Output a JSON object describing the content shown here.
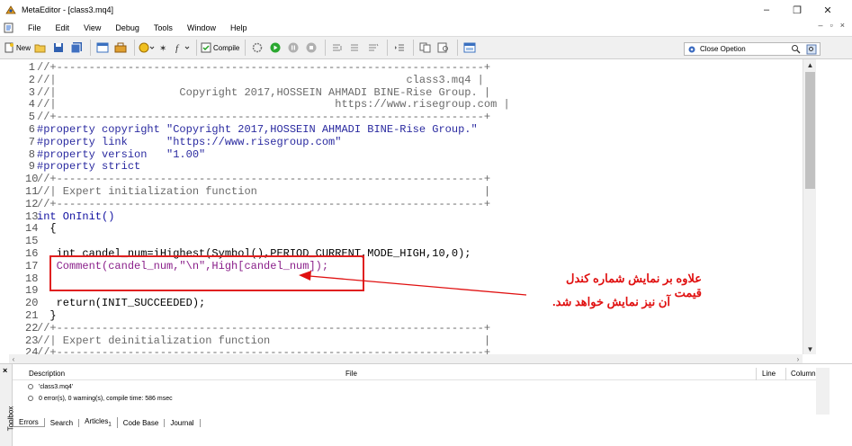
{
  "window": {
    "title": "MetaEditor - [class3.mq4]",
    "minimize": "–",
    "maximize": "❐",
    "close": "✕"
  },
  "menu": {
    "items": [
      "File",
      "Edit",
      "View",
      "Debug",
      "Tools",
      "Window",
      "Help"
    ],
    "mdi": [
      "–",
      "▫",
      "×"
    ]
  },
  "toolbar": {
    "new_label": "New",
    "compile_label": "Compile"
  },
  "search": {
    "value": "Close Opetion"
  },
  "editor": {
    "lines": [
      {
        "n": "1",
        "code": "//+------------------------------------------------------------------+",
        "cls": "c-comment"
      },
      {
        "n": "2",
        "code": "//|                                                      class3.mq4 |",
        "cls": "c-comment"
      },
      {
        "n": "3",
        "code": "//|                   Copyright 2017,HOSSEIN AHMADI BINE-Rise Group. |",
        "cls": "c-comment"
      },
      {
        "n": "4",
        "code": "//|                                           https://www.risegroup.com |",
        "cls": "c-comment"
      },
      {
        "n": "5",
        "code": "//+------------------------------------------------------------------+",
        "cls": "c-comment"
      },
      {
        "n": "6",
        "code": "#property copyright \"Copyright 2017,HOSSEIN AHMADI BINE-Rise Group.\"",
        "cls": "c-prop"
      },
      {
        "n": "7",
        "code": "#property link      \"https://www.risegroup.com\"",
        "cls": "c-prop"
      },
      {
        "n": "8",
        "code": "#property version   \"1.00\"",
        "cls": "c-prop"
      },
      {
        "n": "9",
        "code": "#property strict",
        "cls": "c-prop"
      },
      {
        "n": "10",
        "code": "//+------------------------------------------------------------------+",
        "cls": "c-comment"
      },
      {
        "n": "11",
        "code": "//| Expert initialization function                                   |",
        "cls": "c-comment"
      },
      {
        "n": "12",
        "code": "//+------------------------------------------------------------------+",
        "cls": "c-comment"
      },
      {
        "n": "13",
        "code": "int OnInit()",
        "cls": "c-kw"
      },
      {
        "n": "14",
        "code": "  {",
        "cls": "c-text"
      },
      {
        "n": "15",
        "code": "",
        "cls": "c-text"
      },
      {
        "n": "16",
        "code": "   int candel_num=iHighest(Symbol(),PERIOD_CURRENT,MODE_HIGH,10,0);",
        "cls": "c-text"
      },
      {
        "n": "17",
        "code": "   Comment(candel_num,\"\\n\",High[candel_num]);",
        "cls": "c-fn"
      },
      {
        "n": "18",
        "code": "",
        "cls": "c-text"
      },
      {
        "n": "19",
        "code": "",
        "cls": "c-text"
      },
      {
        "n": "20",
        "code": "   return(INIT_SUCCEEDED);",
        "cls": "c-text"
      },
      {
        "n": "21",
        "code": "  }",
        "cls": "c-text"
      },
      {
        "n": "22",
        "code": "//+------------------------------------------------------------------+",
        "cls": "c-comment"
      },
      {
        "n": "23",
        "code": "//| Expert deinitialization function                                 |",
        "cls": "c-comment"
      },
      {
        "n": "24",
        "code": "//+------------------------------------------------------------------+",
        "cls": "c-comment"
      }
    ]
  },
  "annotation": {
    "line1": "علاوه بر نمایش شماره کندل قیمت",
    "line2": "آن نیز نمایش خواهد شد.",
    "color": "#e01010"
  },
  "toolbox": {
    "side_label": "Toolbox",
    "columns": {
      "description": "Description",
      "file": "File",
      "line": "Line",
      "column": "Column"
    },
    "messages": [
      "'class3.mq4'",
      "0 error(s), 0 warning(s), compile time: 586 msec"
    ],
    "tabs": [
      "Errors",
      "Search",
      "Articles",
      "Code Base",
      "Journal"
    ],
    "articles_badge": "1"
  }
}
